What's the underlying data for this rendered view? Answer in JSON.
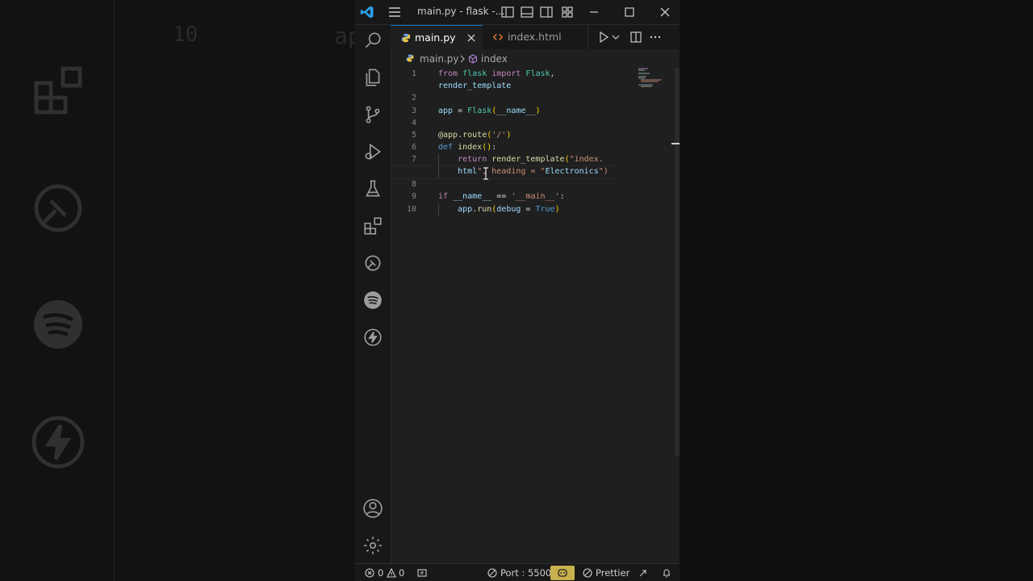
{
  "window": {
    "title": "main.py - flask -...",
    "controls": [
      "toggle-primary-sidebar",
      "toggle-panel",
      "toggle-secondary-sidebar",
      "customize-layout",
      "minimize",
      "maximize",
      "close"
    ]
  },
  "activity_bar": {
    "top_icons": [
      "explorer-icon",
      "search-icon",
      "source-control-icon",
      "run-debug-icon",
      "testing-icon",
      "extensions-icon",
      "remote-explorer-icon",
      "spotify-icon",
      "thunder-client-icon"
    ],
    "bottom_icons": [
      "account-icon",
      "manage-gear-icon"
    ]
  },
  "tabs": [
    {
      "label": "main.py",
      "active": true,
      "icon": "python-icon"
    },
    {
      "label": "index.html",
      "active": false,
      "icon": "html-icon"
    }
  ],
  "breadcrumb": {
    "file": "main.py",
    "symbol": "index"
  },
  "editor": {
    "line_numbers": [
      "1",
      "",
      "2",
      "3",
      "4",
      "5",
      "6",
      "7",
      "",
      "8",
      "9",
      "10"
    ],
    "lines": [
      "from flask import Flask,",
      "render_template",
      "",
      "app = Flask(__name__)",
      "",
      "@app.route('/')",
      "def index():",
      "    return render_template(\"index.",
      "    html\", heading = \"Electronics\")",
      "",
      "if __name__ == '__main__':",
      "    app.run(debug = True)"
    ]
  },
  "background": {
    "ghost_line_number": "10",
    "ghost_code": "ap"
  },
  "status_bar": {
    "errors": "0",
    "warnings": "0",
    "port": "Port : 5500",
    "prettier": "Prettier"
  },
  "colors": {
    "accent": "#0078d4",
    "keyword": "#c586c0",
    "function": "#dcdcaa",
    "class": "#4ec9b0",
    "variable": "#9cdcfe",
    "string": "#ce9178",
    "copilot_badge": "#c8b14d"
  }
}
